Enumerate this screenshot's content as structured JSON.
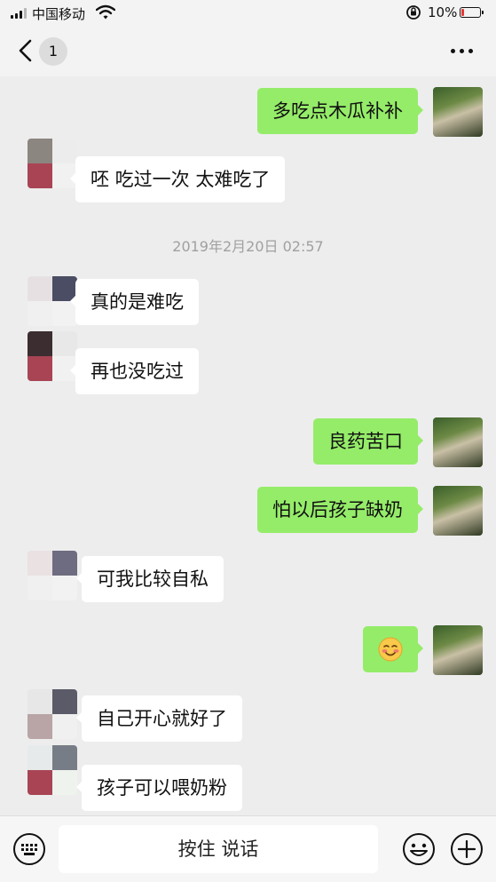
{
  "status_bar": {
    "carrier": "中国移动",
    "battery_percent": "10%",
    "icons": [
      "signal-icon",
      "wifi-icon",
      "rotation-lock-icon",
      "battery-icon"
    ]
  },
  "nav": {
    "back_icon": "chevron-left-icon",
    "unread_count": "1",
    "more_icon": "more-dots-icon"
  },
  "messages": [
    {
      "side": "out",
      "text": "多吃点木瓜补补"
    },
    {
      "side": "in",
      "text": "呸 吃过一次 太难吃了"
    },
    {
      "type": "timestamp",
      "text": "2019年2月20日 02:57"
    },
    {
      "side": "in",
      "text": "真的是难吃"
    },
    {
      "side": "in",
      "text": "再也没吃过"
    },
    {
      "side": "out",
      "text": "良药苦口"
    },
    {
      "side": "out",
      "text": "怕以后孩子缺奶"
    },
    {
      "side": "in",
      "text": "可我比较自私"
    },
    {
      "side": "out",
      "emoji": "blushing-smile-emoji"
    },
    {
      "side": "in",
      "text": "自己开心就好了"
    },
    {
      "side": "in",
      "text": "孩子可以喂奶粉"
    }
  ],
  "input_bar": {
    "keyboard_icon": "keyboard-icon",
    "hold_to_talk_label": "按住 说话",
    "emoji_icon": "smiley-icon",
    "plus_icon": "plus-circle-icon"
  },
  "colors": {
    "outgoing_bubble": "#95ec69",
    "incoming_bubble": "#ffffff",
    "chat_background": "#ededed",
    "battery_low": "#e53935"
  }
}
